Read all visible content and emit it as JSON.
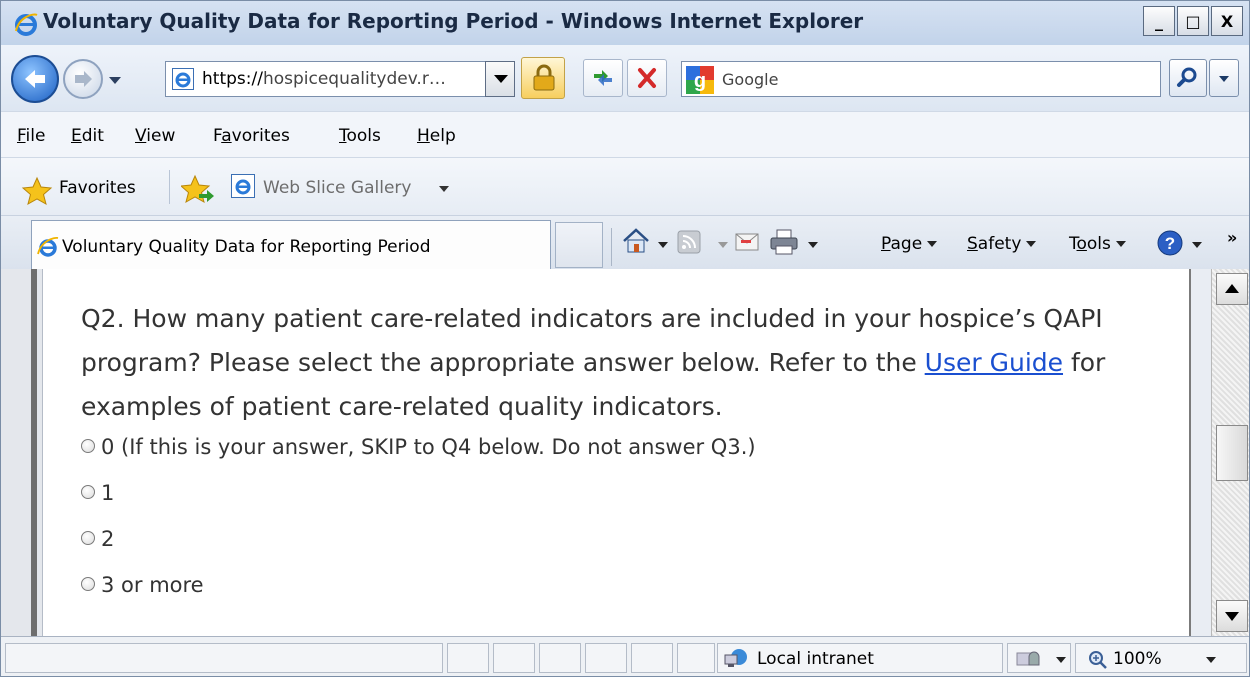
{
  "window": {
    "title": "Voluntary Quality Data for Reporting Period - Windows Internet Explorer",
    "buttons": [
      "_",
      "□",
      "X"
    ]
  },
  "addressbar": {
    "url_scheme": "https://",
    "url_rest": "hospicequalitydev.r…",
    "search_placeholder": "Google"
  },
  "menu": {
    "items": [
      {
        "accel": "F",
        "rest": "ile"
      },
      {
        "accel": "E",
        "rest": "dit"
      },
      {
        "accel": "V",
        "rest": "iew"
      },
      {
        "pre": "F",
        "accel": "a",
        "rest": "vorites"
      },
      {
        "accel": "T",
        "rest": "ools"
      },
      {
        "accel": "H",
        "rest": "elp"
      }
    ]
  },
  "favorites": {
    "label": "Favorites",
    "web_slice_label": "Web Slice Gallery"
  },
  "tabs": {
    "active_title": "Voluntary Quality Data for Reporting Period"
  },
  "commands": {
    "page": {
      "accel": "P",
      "rest": "age"
    },
    "safety": {
      "accel": "S",
      "rest": "afety"
    },
    "tools": {
      "pre": "T",
      "accel": "o",
      "rest": "ols"
    },
    "overflow": "»"
  },
  "content": {
    "question_text_before": "Q2. How many patient care-related indicators are included in your hospice’s QAPI program? Please select the appropriate answer below. Refer to the ",
    "question_link": "User Guide",
    "question_text_after": " for examples of patient care-related quality indicators.",
    "options": [
      "0 (If this is your answer, SKIP to Q4 below. Do not answer Q3.)",
      "1",
      "2",
      "3 or more"
    ]
  },
  "status": {
    "zone": "Local intranet",
    "zoom": "100%"
  },
  "colors": {
    "link": "#1a4fd0",
    "body_text": "#333333",
    "title_bar": "#c2d3ea"
  }
}
